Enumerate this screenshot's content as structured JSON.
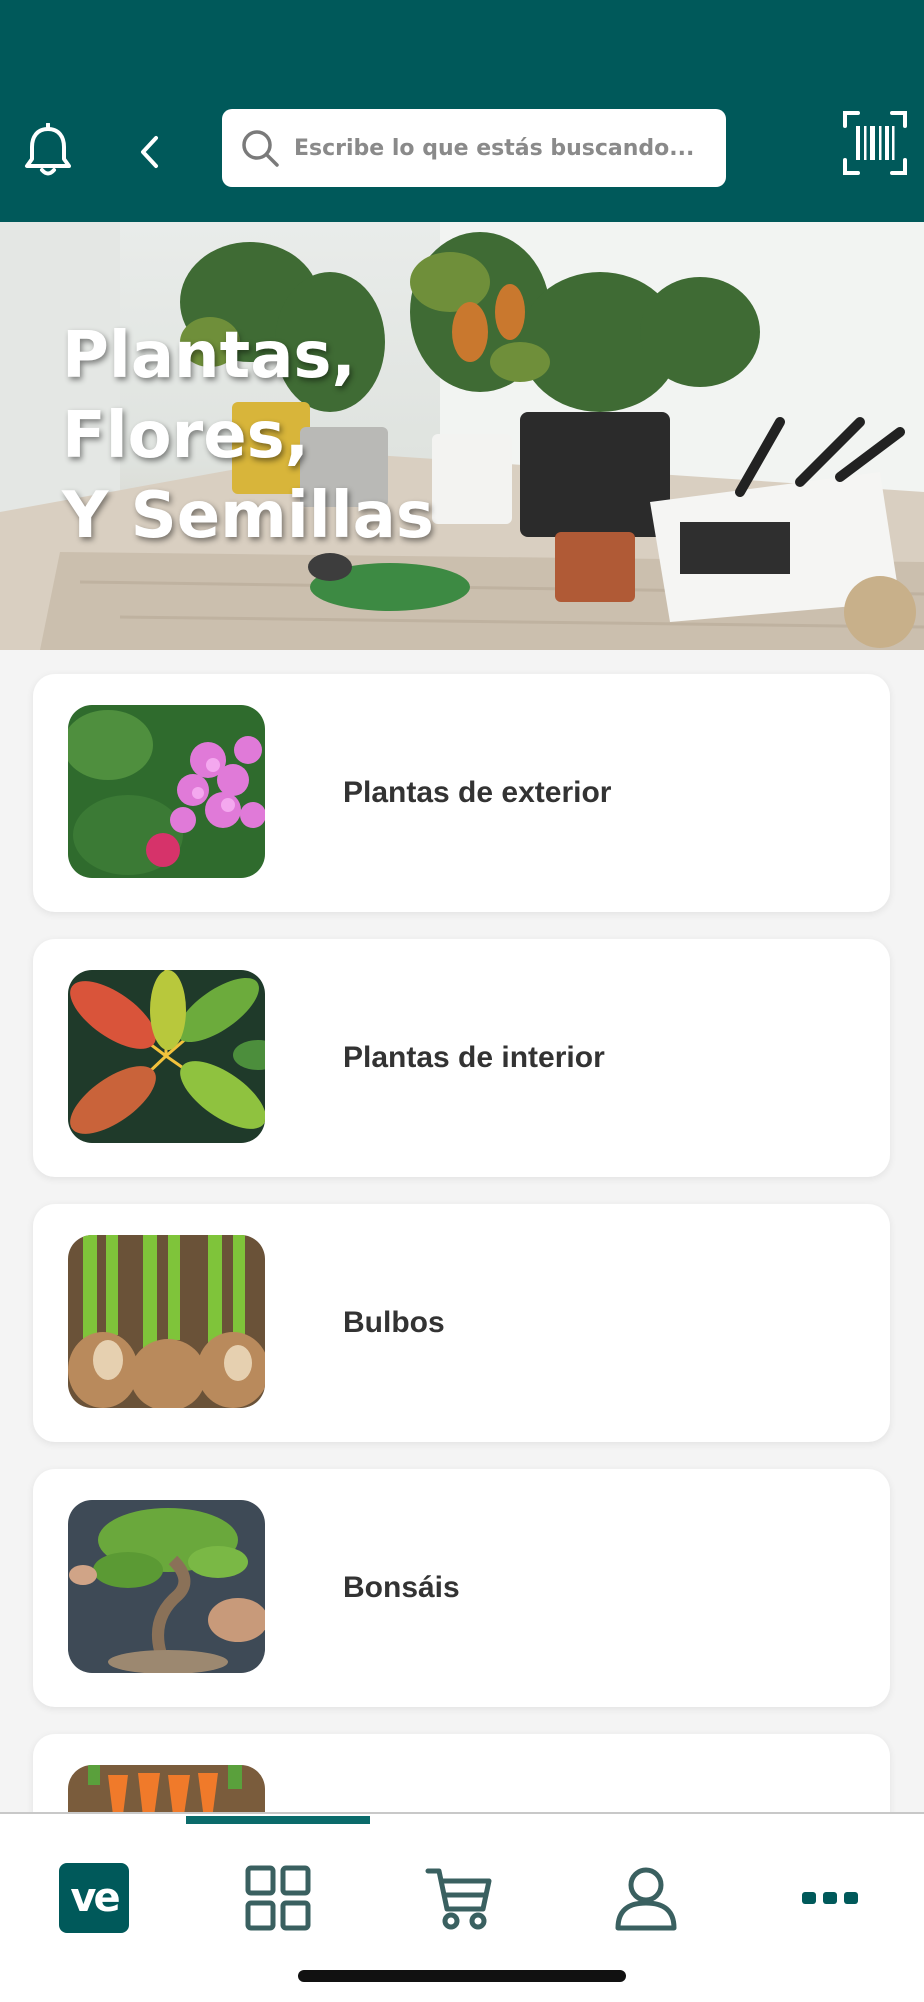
{
  "header": {
    "search_placeholder": "Escribe lo que estás buscando...",
    "icons": [
      "bell-icon",
      "back-chevron-icon",
      "search-icon",
      "barcode-scanner-icon"
    ],
    "background_color": "#00595a"
  },
  "hero": {
    "title": "Plantas,\nFlores,\nY Semillas"
  },
  "categories": [
    {
      "label": "Plantas de exterior"
    },
    {
      "label": "Plantas de interior"
    },
    {
      "label": "Bulbos"
    },
    {
      "label": "Bonsáis"
    },
    {
      "label": ""
    }
  ],
  "bottom_nav": {
    "logo_text": "ve",
    "items": [
      "home-logo",
      "categories-grid-icon",
      "cart-icon",
      "profile-icon",
      "more-icon"
    ],
    "active_item": "categories-grid-icon",
    "accent_color": "#0b6b6b"
  }
}
